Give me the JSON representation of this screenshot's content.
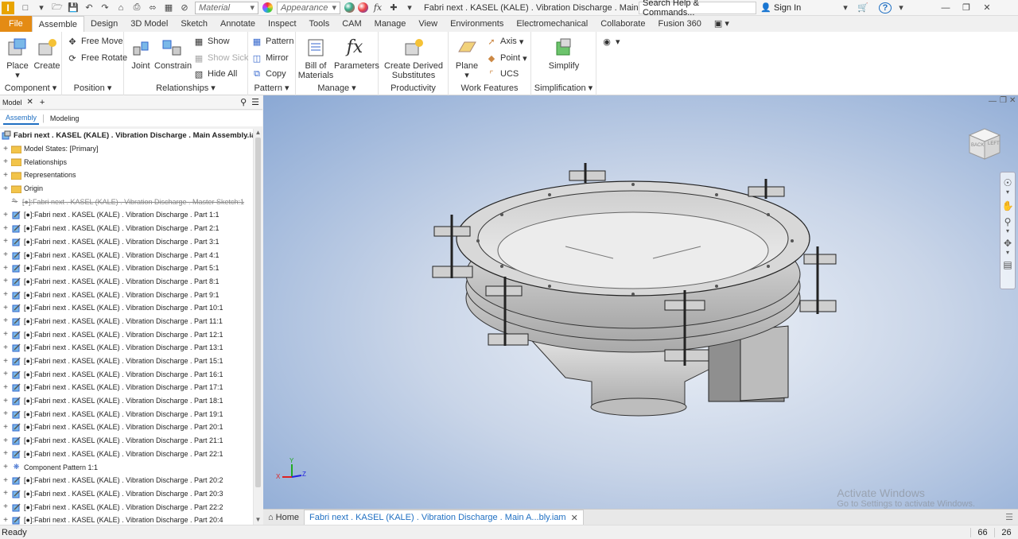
{
  "titlebar": {
    "material_placeholder": "Material",
    "appearance_placeholder": "Appearance",
    "window_title": "Fabri next . KASEL (KALE) . Vibration Discharge . Main Asse...",
    "search_placeholder": "Search Help & Commands...",
    "sign_in": "Sign In",
    "logo": "I"
  },
  "menu_tabs": [
    "File",
    "Assemble",
    "Design",
    "3D Model",
    "Sketch",
    "Annotate",
    "Inspect",
    "Tools",
    "CAM",
    "Manage",
    "View",
    "Environments",
    "Electromechanical",
    "Collaborate",
    "Fusion 360"
  ],
  "ribbon": {
    "component": {
      "title": "Component",
      "place": "Place",
      "create": "Create"
    },
    "position": {
      "title": "Position",
      "free_move": "Free Move",
      "free_rotate": "Free Rotate"
    },
    "relationships": {
      "title": "Relationships",
      "joint": "Joint",
      "constrain": "Constrain",
      "show": "Show",
      "show_sick": "Show Sick",
      "hide_all": "Hide All"
    },
    "pattern": {
      "title": "Pattern",
      "pattern": "Pattern",
      "mirror": "Mirror",
      "copy": "Copy"
    },
    "manage": {
      "title": "Manage",
      "bom_line1": "Bill of",
      "bom_line2": "Materials",
      "parameters": "Parameters"
    },
    "productivity": {
      "title": "Productivity",
      "line1": "Create Derived",
      "line2": "Substitutes"
    },
    "work_features": {
      "title": "Work Features",
      "plane": "Plane",
      "axis": "Axis",
      "point": "Point",
      "ucs": "UCS"
    },
    "simplification": {
      "title": "Simplification",
      "simplify": "Simplify"
    }
  },
  "browser": {
    "title": "Model",
    "tabs": [
      "Assembly",
      "Modeling"
    ],
    "root": "Fabri next . KASEL (KALE) . Vibration Discharge . Main Assembly.iam",
    "folders": [
      "Model States: [Primary]",
      "Relationships",
      "Representations",
      "Origin"
    ],
    "master_sketch": "[●]:Fabri next . KASEL (KALE) . Vibration Discharge . Master Sketch:1",
    "parts": [
      "[●]:Fabri next . KASEL (KALE) . Vibration Discharge . Part 1:1",
      "[●]:Fabri next . KASEL (KALE) . Vibration Discharge . Part 2:1",
      "[●]:Fabri next . KASEL (KALE) . Vibration Discharge . Part 3:1",
      "[●]:Fabri next . KASEL (KALE) . Vibration Discharge . Part 4:1",
      "[●]:Fabri next . KASEL (KALE) . Vibration Discharge . Part 5:1",
      "[●]:Fabri next . KASEL (KALE) . Vibration Discharge . Part 8:1",
      "[●]:Fabri next . KASEL (KALE) . Vibration Discharge . Part 9:1",
      "[●]:Fabri next . KASEL (KALE) . Vibration Discharge . Part 10:1",
      "[●]:Fabri next . KASEL (KALE) . Vibration Discharge . Part 11:1",
      "[●]:Fabri next . KASEL (KALE) . Vibration Discharge . Part 12:1",
      "[●]:Fabri next . KASEL (KALE) . Vibration Discharge . Part 13:1",
      "[●]:Fabri next . KASEL (KALE) . Vibration Discharge . Part 15:1",
      "[●]:Fabri next . KASEL (KALE) . Vibration Discharge . Part 16:1",
      "[●]:Fabri next . KASEL (KALE) . Vibration Discharge . Part 17:1",
      "[●]:Fabri next . KASEL (KALE) . Vibration Discharge . Part 18:1",
      "[●]:Fabri next . KASEL (KALE) . Vibration Discharge . Part 19:1",
      "[●]:Fabri next . KASEL (KALE) . Vibration Discharge . Part 20:1",
      "[●]:Fabri next . KASEL (KALE) . Vibration Discharge . Part 21:1",
      "[●]:Fabri next . KASEL (KALE) . Vibration Discharge . Part 22:1"
    ],
    "component_pattern": "Component Pattern 1:1",
    "parts_after": [
      "[●]:Fabri next . KASEL (KALE) . Vibration Discharge . Part 20:2",
      "[●]:Fabri next . KASEL (KALE) . Vibration Discharge . Part 20:3",
      "[●]:Fabri next . KASEL (KALE) . Vibration Discharge . Part 22:2",
      "[●]:Fabri next . KASEL (KALE) . Vibration Discharge . Part 20:4"
    ]
  },
  "viewcube": {
    "back": "BACK",
    "left": "LEFT"
  },
  "triad": {
    "x": "X",
    "y": "Y",
    "z": "Z"
  },
  "doc_tabs": {
    "home": "Home",
    "active": "Fabri next . KASEL (KALE) . Vibration Discharge . Main A...bly.iam"
  },
  "status": {
    "left": "Ready",
    "num1": "66",
    "num2": "26"
  },
  "watermark": {
    "line1": "Activate Windows",
    "line2": "Go to Settings to activate Windows."
  },
  "colors": {
    "file_tab": "#e48b14",
    "accent_blue": "#1f6fc2",
    "folder": "#f2c44a"
  }
}
